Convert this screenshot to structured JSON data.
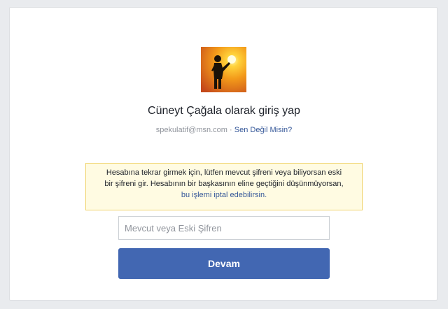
{
  "profile": {
    "name_heading": "Cüneyt Çağala olarak giriş yap",
    "email": "spekulatif@msn.com",
    "separator": " · ",
    "not_you_link": "Sen Değil Misin?"
  },
  "notice": {
    "line1": "Hesabına tekrar girmek için, lütfen mevcut şifreni veya biliyorsan eski",
    "line2": "bir şifreni gir. Hesabının bir başkasının eline geçtiğini düşünmüyorsan,",
    "line3": "bu işlemi iptal edebilirsin."
  },
  "form": {
    "password_placeholder": "Mevcut veya Eski Şifren",
    "password_value": "",
    "continue_label": "Devam"
  },
  "colors": {
    "background": "#e9ebee",
    "link": "#365899",
    "button": "#4267b2",
    "notice_bg": "#fffbe2",
    "notice_border": "#f0d46e"
  },
  "icons": {
    "avatar": "profile-photo-silhouette-sunset"
  }
}
